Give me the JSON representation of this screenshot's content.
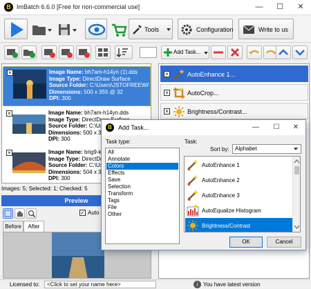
{
  "window": {
    "title": "ImBatch 6.6.0 [Free for non-commercial use]",
    "logo_letter": "B"
  },
  "toolbar": {
    "tools_label": "Tools",
    "configuration_label": "Configuration",
    "write_label": "Write to us"
  },
  "task_toolbar": {
    "add_task_label": "Add Task..."
  },
  "images": [
    {
      "name_label": "Image Name:",
      "name": "bh7am-h14yn (1).dds",
      "type_label": "Image Type:",
      "type": "DirectDraw Surface",
      "folder_label": "Source Folder:",
      "folder": "C:\\Users\\JSTOFREEWAR",
      "dim_label": "Dimensions:",
      "dims": "500 x 355 @ 32",
      "dpi_label": "DPI:",
      "dpi": "300",
      "selected": true
    },
    {
      "name_label": "Image Name:",
      "name": "bh7am-h14yn.dds",
      "type_label": "Image Type:",
      "type": "DirectDraw Surface",
      "folder_label": "Source Folder:",
      "folder": "C:\\Users\\JSTOFREEWAR",
      "dim_label": "Dimensions:",
      "dims": "500 x 355 @ 32",
      "dpi_label": "DPI:",
      "dpi": "300",
      "selected": false
    },
    {
      "name_label": "Image Name:",
      "name": "brig9-k9ed4.dds",
      "type_label": "Image Type:",
      "type": "DirectDraw Surface",
      "folder_label": "Source Folder:",
      "folder": "C:\\Users\\JSTOFREEWAR",
      "dim_label": "Dimensions:",
      "dims": "504 x 340 @ 32",
      "dpi_label": "DPI:",
      "dpi": "300",
      "selected": false
    }
  ],
  "image_status": "Images: 5; Selected: 1; Checked: 5",
  "preview": {
    "title": "Preview",
    "auto_label": "Auto",
    "tab_before": "Before",
    "tab_after": "After"
  },
  "tasks": [
    {
      "label": "AutoEnhance 1...",
      "selected": true
    },
    {
      "label": "AutoCrop...",
      "selected": false
    },
    {
      "label": "Brightness/Contrast...",
      "selected": false
    }
  ],
  "dialog": {
    "title": "Add Task...",
    "task_type_label": "Task type:",
    "task_label": "Task:",
    "sort_label": "Sort by:",
    "sort_value": "Alphabet",
    "types": [
      "All",
      "Annotate",
      "Colors",
      "Effects",
      "Save",
      "Selection",
      "Transform",
      "Tags",
      "File",
      "Other"
    ],
    "selected_type": "Colors",
    "task_items": [
      "AutoEnhance 1",
      "AutoEnhance 2",
      "AutoEnhance 3",
      "AutoEqualize Histogram",
      "Brightness/Contrast"
    ],
    "selected_task": "Brightness/Contrast",
    "ok_label": "OK",
    "cancel_label": "Cancel"
  },
  "status": {
    "licensed_label": "Licensed to:",
    "licensed_value": "<Click to set your name here>",
    "version_text": "You have latest version"
  }
}
